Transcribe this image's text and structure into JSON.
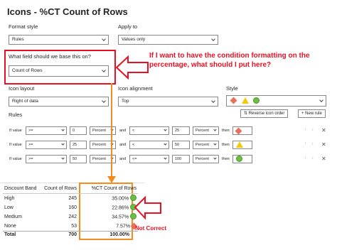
{
  "title": "Icons - %CT Count of Rows",
  "format_style": {
    "label": "Format style",
    "value": "Rules"
  },
  "apply_to": {
    "label": "Apply to",
    "value": "Values only"
  },
  "field": {
    "label": "What field should we base this on?",
    "value": "Count of Rows"
  },
  "callout_text": "If I want to have the condition formatting on the percentage, what should I put here?",
  "icon_layout": {
    "label": "Icon layout",
    "value": "Right of data"
  },
  "icon_alignment": {
    "label": "Icon alignment",
    "value": "Top"
  },
  "style": {
    "label": "Style"
  },
  "rules_label": "Rules",
  "reverse_label": "Reverse icon order",
  "new_rule_label": "New rule",
  "rules": [
    {
      "if": "If value",
      "op1": ">=",
      "v1": "0",
      "unit1": "Percent",
      "and": "and",
      "op2": "<",
      "v2": "25",
      "unit2": "Percent",
      "then": "then",
      "icon": "diamond-red"
    },
    {
      "if": "If value",
      "op1": ">=",
      "v1": "25",
      "unit1": "Percent",
      "and": "and",
      "op2": "<",
      "v2": "50",
      "unit2": "Percent",
      "then": "then",
      "icon": "triangle-yellow"
    },
    {
      "if": "If value",
      "op1": ">=",
      "v1": "50",
      "unit1": "Percent",
      "and": "and",
      "op2": "<=",
      "v2": "100",
      "unit2": "Percent",
      "then": "then",
      "icon": "circle-green"
    }
  ],
  "table": {
    "headers": [
      "Discount Band",
      "Count of Rows",
      "%CT Count of Rows"
    ],
    "rows": [
      {
        "band": "High",
        "count": "245",
        "pct": "35.00%",
        "icon": "circle-green"
      },
      {
        "band": "Low",
        "count": "160",
        "pct": "22.86%",
        "icon": "circle-green"
      },
      {
        "band": "Medium",
        "count": "242",
        "pct": "34.57%",
        "icon": "circle-green"
      },
      {
        "band": "None",
        "count": "53",
        "pct": "7.57%",
        "icon": "diamond-red"
      }
    ],
    "total": {
      "band": "Total",
      "count": "700",
      "pct": "100.00%"
    }
  },
  "not_correct": "Not Correct",
  "colors": {
    "red": "#e81123",
    "orange": "#f28c1d",
    "green": "#6cbe45",
    "yellow": "#f2c811"
  }
}
